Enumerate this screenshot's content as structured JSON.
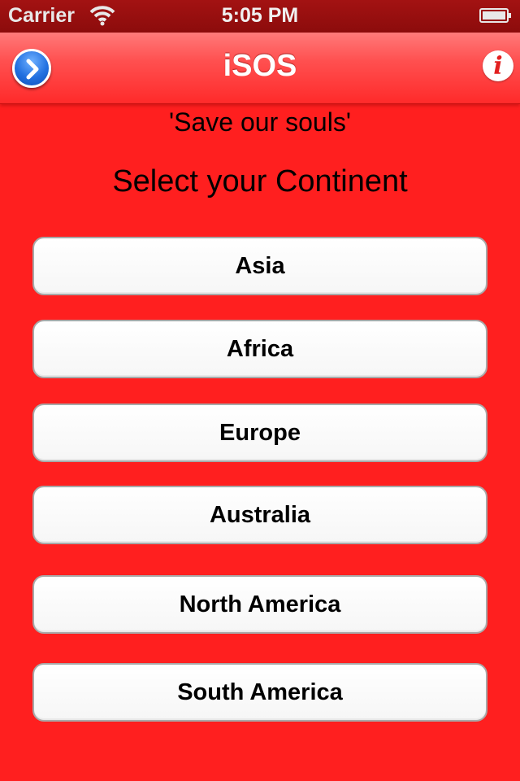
{
  "status_bar": {
    "carrier": "Carrier",
    "time": "5:05 PM",
    "wifi_icon": "wifi-icon",
    "battery_icon": "battery-icon"
  },
  "nav_bar": {
    "title": "iSOS",
    "left_button_icon": "chevron-right-circle-icon",
    "info_glyph": "i",
    "info_icon": "info-icon"
  },
  "content": {
    "tagline": "'Save our souls'",
    "heading": "Select your Continent",
    "continents": [
      "Asia",
      "Africa",
      "Europe",
      "Australia",
      "North America",
      "South America"
    ]
  },
  "colors": {
    "background": "#ff1f1f",
    "nav_bar": "#ff5050",
    "status_bar": "#8c0c0c",
    "button_background": "#ffffff",
    "info_accent": "#e22020",
    "next_button": "#2270e0"
  }
}
